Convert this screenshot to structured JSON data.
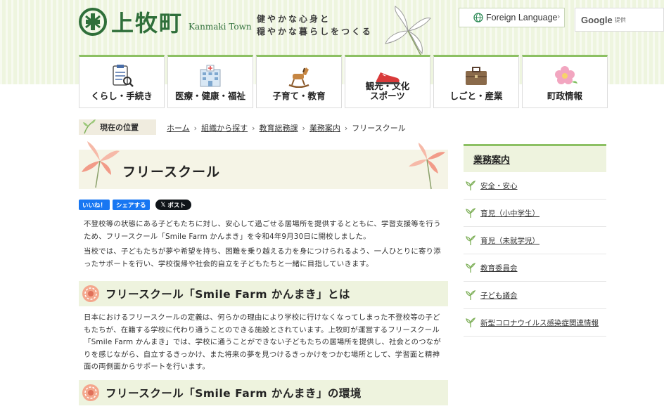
{
  "header": {
    "logo_jp": "上牧町",
    "logo_en": "Kanmaki Town",
    "tagline_1": "健やかな心身と",
    "tagline_2": "穏やかな暮らしをつくる",
    "foreign_language": "Foreign Language",
    "google_label": "Google",
    "google_suffix": "提供"
  },
  "nav": [
    {
      "label": "くらし・手続き",
      "icon": "clipboard-icon"
    },
    {
      "label": "医療・健康・福祉",
      "icon": "hospital-icon"
    },
    {
      "label": "子育て・教育",
      "icon": "rocking-horse-icon"
    },
    {
      "label": "観光・文化\nスポーツ",
      "icon": "sneaker-icon"
    },
    {
      "label": "しごと・産業",
      "icon": "briefcase-icon"
    },
    {
      "label": "町政情報",
      "icon": "flower-icon"
    }
  ],
  "breadcrumb": {
    "here_label": "現在の位置",
    "items": [
      "ホーム",
      "組織から探す",
      "教育総務課",
      "業務案内",
      "フリースクール"
    ]
  },
  "page": {
    "title": "フリースクール",
    "social": {
      "like": "いいね！",
      "share": "シェアする",
      "post": "ポスト"
    },
    "intro_1": "不登校等の状態にある子どもたちに対し、安心して過ごせる居場所を提供するとともに、学習支援等を行うため、フリースクール「Smile Farm かんまき」を令和4年9月30日に開校しました。",
    "intro_2": "当校では、子どもたちが夢や希望を持ち、困難を乗り越える力を身につけられるよう、一人ひとりに寄り添ったサポートを行い、学校復帰や社会的自立を子どもたちと一緒に目指していきます。",
    "h2_1": "フリースクール「Smile Farm かんまき」とは",
    "body_1": "日本におけるフリースクールの定義は、何らかの理由により学校に行けなくなってしまった不登校等の子どもたちが、在籍する学校に代わり通うことのできる施設とされています。上牧町が運営するフリースクール「Smile Farm かんまき」では、学校に通うことができない子どもたちの居場所を提供し、社会とのつながりを感じながら、自立するきっかけ、また将来の夢を見つけるきっかけをつかむ場所として、学習面と精神面の両側面からサポートを行います。",
    "h2_2": "フリースクール「Smile Farm かんまき」の環境"
  },
  "sidebar": {
    "heading": "業務案内",
    "items": [
      "安全・安心",
      "育児（小中学生）",
      "育児（未就学児）",
      "教育委員会",
      "子ども議会",
      "新型コロナウイルス感染症関連情報"
    ]
  },
  "colors": {
    "accent_green": "#8cc063",
    "logo_green": "#2f6f3a",
    "facebook_blue": "#1877f2"
  }
}
